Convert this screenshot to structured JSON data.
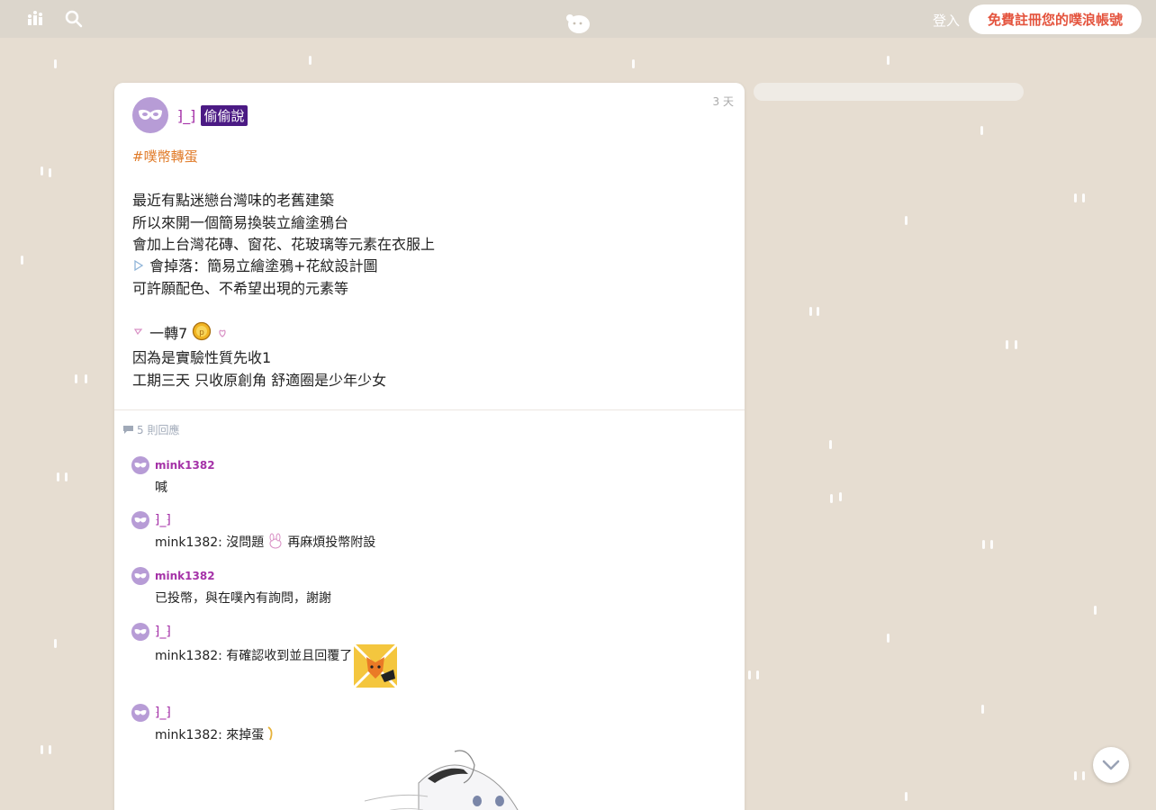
{
  "topbar": {
    "login_label": "登入",
    "signup_label": "免費註冊您的噗浪帳號",
    "icons": [
      "chart-icon",
      "search-icon",
      "plurk-logo-icon"
    ]
  },
  "post": {
    "author": "⁆_⁆",
    "badge": "偷偷說",
    "time": "3 天",
    "hashtag": "#噗幣轉蛋",
    "lines": [
      "最近有點迷戀台灣味的老舊建築",
      "所以來開一個簡易換裝立繪塗鴉台",
      "會加上台灣花磚、窗花、花玻璃等元素在衣服上",
      "會掉落：簡易立繪塗鴉+花紋設計圖",
      "可許願配色、不希望出現的元素等",
      "一轉7",
      "因為是實驗性質先收1",
      "工期三天 只收原創角 舒適圈是少年少女"
    ]
  },
  "replies": {
    "count_label": "5 則回應",
    "items": [
      {
        "name": "mink1382",
        "text": "喊"
      },
      {
        "name": "⁆_⁆",
        "text": "mink1382: 沒問題",
        "text2": "再麻煩投幣附設"
      },
      {
        "name": "mink1382",
        "text": "已投幣，與在噗內有詢問，謝謝"
      },
      {
        "name": "⁆_⁆",
        "text": "mink1382: 有確認收到並且回覆了"
      },
      {
        "name": "⁆_⁆",
        "text": "mink1382: 來掉蛋"
      }
    ]
  },
  "colors": {
    "background": "#e6ddd1",
    "accent": "#a532a8",
    "signup": "#e4543e",
    "badge": "#4b1a84",
    "hashtag": "#e07b29"
  }
}
